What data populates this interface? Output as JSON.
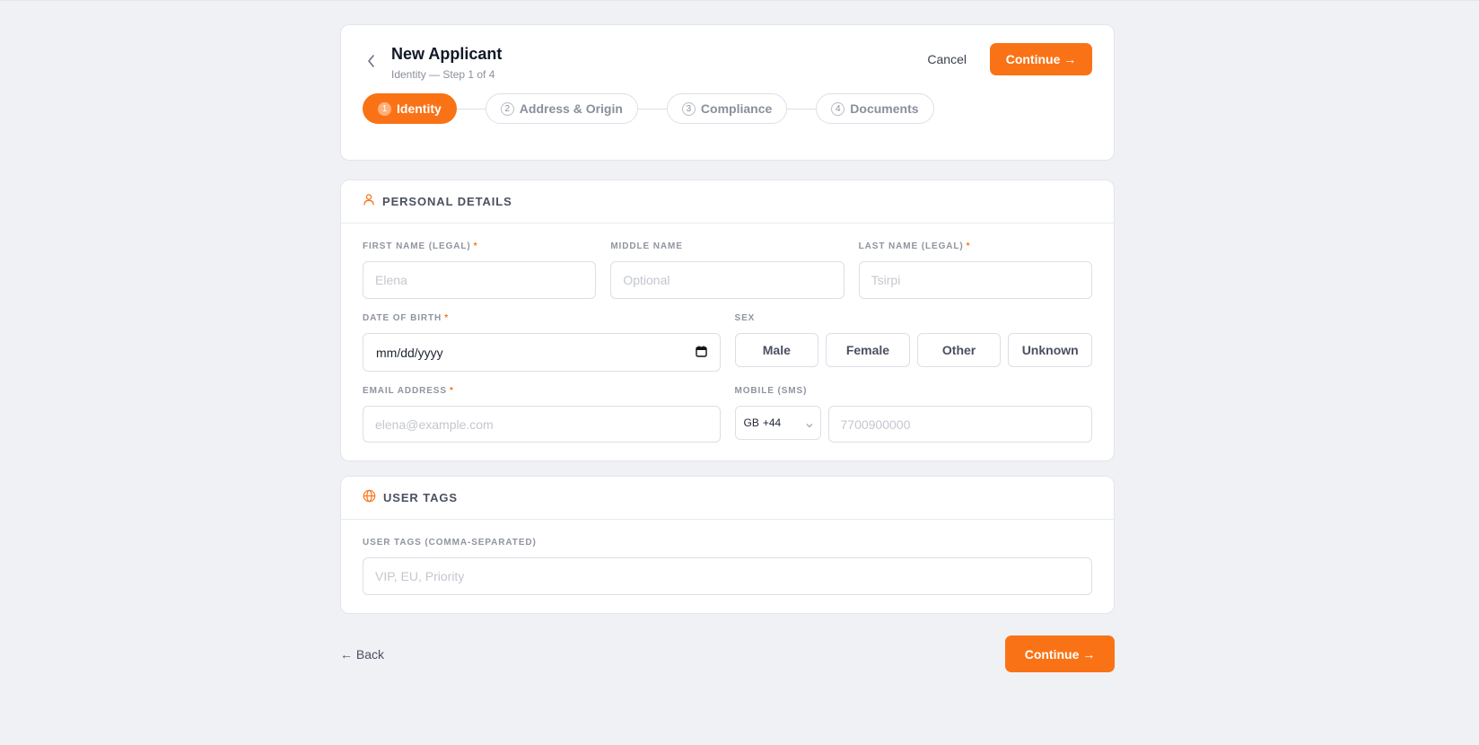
{
  "header": {
    "title": "New Applicant",
    "subtitle": "Identity — Step 1 of 4",
    "cancel_label": "Cancel",
    "continue_label": "Continue →"
  },
  "steps": [
    {
      "num": "1",
      "label": "Identity",
      "active": true
    },
    {
      "num": "2",
      "label": "Address & Origin",
      "active": false
    },
    {
      "num": "3",
      "label": "Compliance",
      "active": false
    },
    {
      "num": "4",
      "label": "Documents",
      "active": false
    }
  ],
  "personal": {
    "title": "PERSONAL DETAILS",
    "first_name": {
      "label": "FIRST NAME (LEGAL)",
      "required": "*",
      "placeholder": "Elena",
      "value": ""
    },
    "middle_name": {
      "label": "MIDDLE NAME",
      "placeholder": "Optional",
      "value": ""
    },
    "last_name": {
      "label": "LAST NAME (LEGAL)",
      "required": "*",
      "placeholder": "Tsirpi",
      "value": ""
    },
    "dob": {
      "label": "DATE OF BIRTH",
      "required": "*",
      "value": "mm/dd/yyyy"
    },
    "sex": {
      "label": "SEX",
      "options": [
        "Male",
        "Female",
        "Other",
        "Unknown"
      ]
    },
    "email": {
      "label": "EMAIL ADDRESS",
      "required": "*",
      "placeholder": "elena@example.com",
      "value": ""
    },
    "mobile": {
      "label": "MOBILE (SMS)",
      "country_code": "GB",
      "dial_code": "+44",
      "placeholder": "7700900000",
      "value": ""
    }
  },
  "tags": {
    "title": "USER TAGS",
    "field_label": "USER TAGS (COMMA-SEPARATED)",
    "placeholder": "VIP, EU, Priority",
    "value": ""
  },
  "footer": {
    "back_label": "← Back",
    "continue_label": "Continue →"
  },
  "colors": {
    "accent": "#f97316",
    "background": "#f0f1f5"
  }
}
